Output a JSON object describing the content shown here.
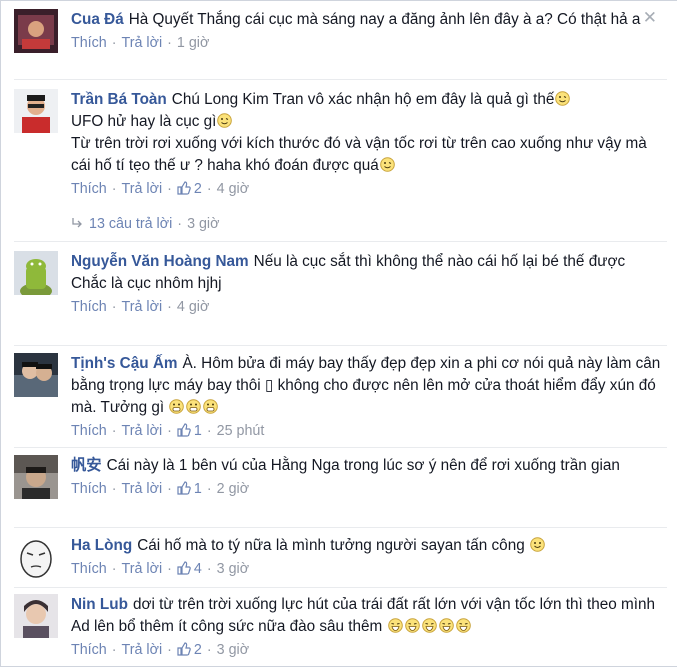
{
  "close_glyph": "✕",
  "action_labels": {
    "like": "Thích",
    "reply": "Trả lời",
    "separator": "·"
  },
  "colors": {
    "author": "#365899",
    "link": "#6d84b4",
    "meta": "#9197a3",
    "text": "#141823"
  },
  "comments": [
    {
      "author": "Cua Đá",
      "text": "Hà Quyết Thắng cái cục mà sáng nay a đăng ảnh lên đây à a? Có thật hả a",
      "likes": "",
      "time": "1 giờ",
      "emoji_after_text": 0
    },
    {
      "author": "Trần Bá Toàn",
      "text": "Chú Long Kim Tran vô xác nhận hộ em đây là quả gì thế",
      "text2": "UFO hử hay là cục gì",
      "text3": "Từ trên trời rơi xuống với kích thước đó và vận tốc rơi từ trên cao xuống như vậy mà cái hố tí tẹo thế ư ? haha khó đoán được quá",
      "likes": "2",
      "time": "4 giờ",
      "replies": "13 câu trả lời",
      "replies_time": "3 giờ"
    },
    {
      "author": "Nguyễn Văn Hoàng Nam",
      "text": "Nếu là cục sắt thì không thể nào cái hố lại bé thế được",
      "text2": "Chắc là cục nhôm hjhj",
      "likes": "",
      "time": "4 giờ"
    },
    {
      "author": "Tịnh's Cậu Ấm",
      "text": "À. Hôm bửa đi máy bay thấy đẹp đẹp xin a phi cơ nói quả này làm cân bằng trọng lực máy bay thôi",
      "text_box_glyph": "▯",
      "text_rest": "không cho được nên lên mở cửa thoát hiểm đẩy xún đó mà. Tưởng gì",
      "likes": "1",
      "time": "25 phút",
      "emoji_after_text": 3
    },
    {
      "author": "帆安",
      "text": "Cái này là 1 bên vú của Hằng Nga trong lúc sơ ý nên để rơi xuống trần gian",
      "likes": "1",
      "time": "2 giờ"
    },
    {
      "author": "Ha Lòng",
      "text": "Cái hố mà to tý nữa là mình tưởng người sayan tấn công",
      "likes": "4",
      "time": "3 giờ",
      "emoji_after_text": 1
    },
    {
      "author": "Nin Lub",
      "text": "dơi từ trên trời xuống lực hút của trái đất rất lớn với vận tốc lớn thì theo mình Ad lên bổ thêm ít công sức nữa đào sâu thêm",
      "likes": "2",
      "time": "3 giờ",
      "emoji_after_text": 5
    }
  ]
}
